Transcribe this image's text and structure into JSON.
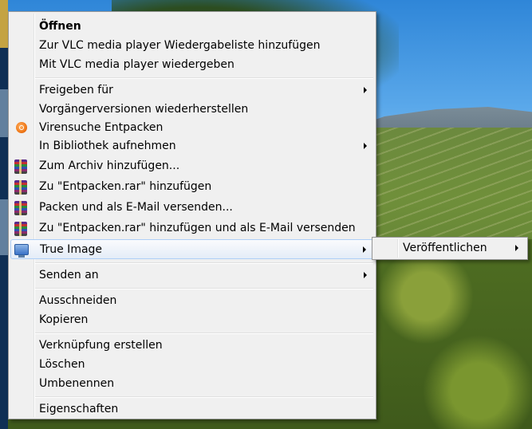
{
  "context_menu": {
    "items": [
      {
        "label": "Öffnen",
        "bold": true
      },
      {
        "label": "Zur VLC media player Wiedergabeliste hinzufügen"
      },
      {
        "label": "Mit VLC media player wiedergeben"
      },
      {
        "label": "Freigeben für",
        "submenu": true
      },
      {
        "label": "Vorgängerversionen wiederherstellen"
      },
      {
        "label": "Virensuche Entpacken",
        "icon": "avast-icon"
      },
      {
        "label": "In Bibliothek aufnehmen",
        "submenu": true
      },
      {
        "label": "Zum Archiv hinzufügen...",
        "icon": "winrar-icon"
      },
      {
        "label": "Zu \"Entpacken.rar\" hinzufügen",
        "icon": "winrar-icon"
      },
      {
        "label": "Packen und als E-Mail versenden...",
        "icon": "winrar-icon"
      },
      {
        "label": "Zu \"Entpacken.rar\" hinzufügen und als E-Mail versenden",
        "icon": "winrar-icon"
      },
      {
        "label": "True Image",
        "icon": "true-image-icon",
        "submenu": true,
        "highlighted": true
      },
      {
        "label": "Senden an",
        "submenu": true
      },
      {
        "label": "Ausschneiden"
      },
      {
        "label": "Kopieren"
      },
      {
        "label": "Verknüpfung erstellen"
      },
      {
        "label": "Löschen"
      },
      {
        "label": "Umbenennen"
      },
      {
        "label": "Eigenschaften"
      }
    ]
  },
  "submenu": {
    "items": [
      {
        "label": "Veröffentlichen",
        "submenu": true
      }
    ]
  }
}
